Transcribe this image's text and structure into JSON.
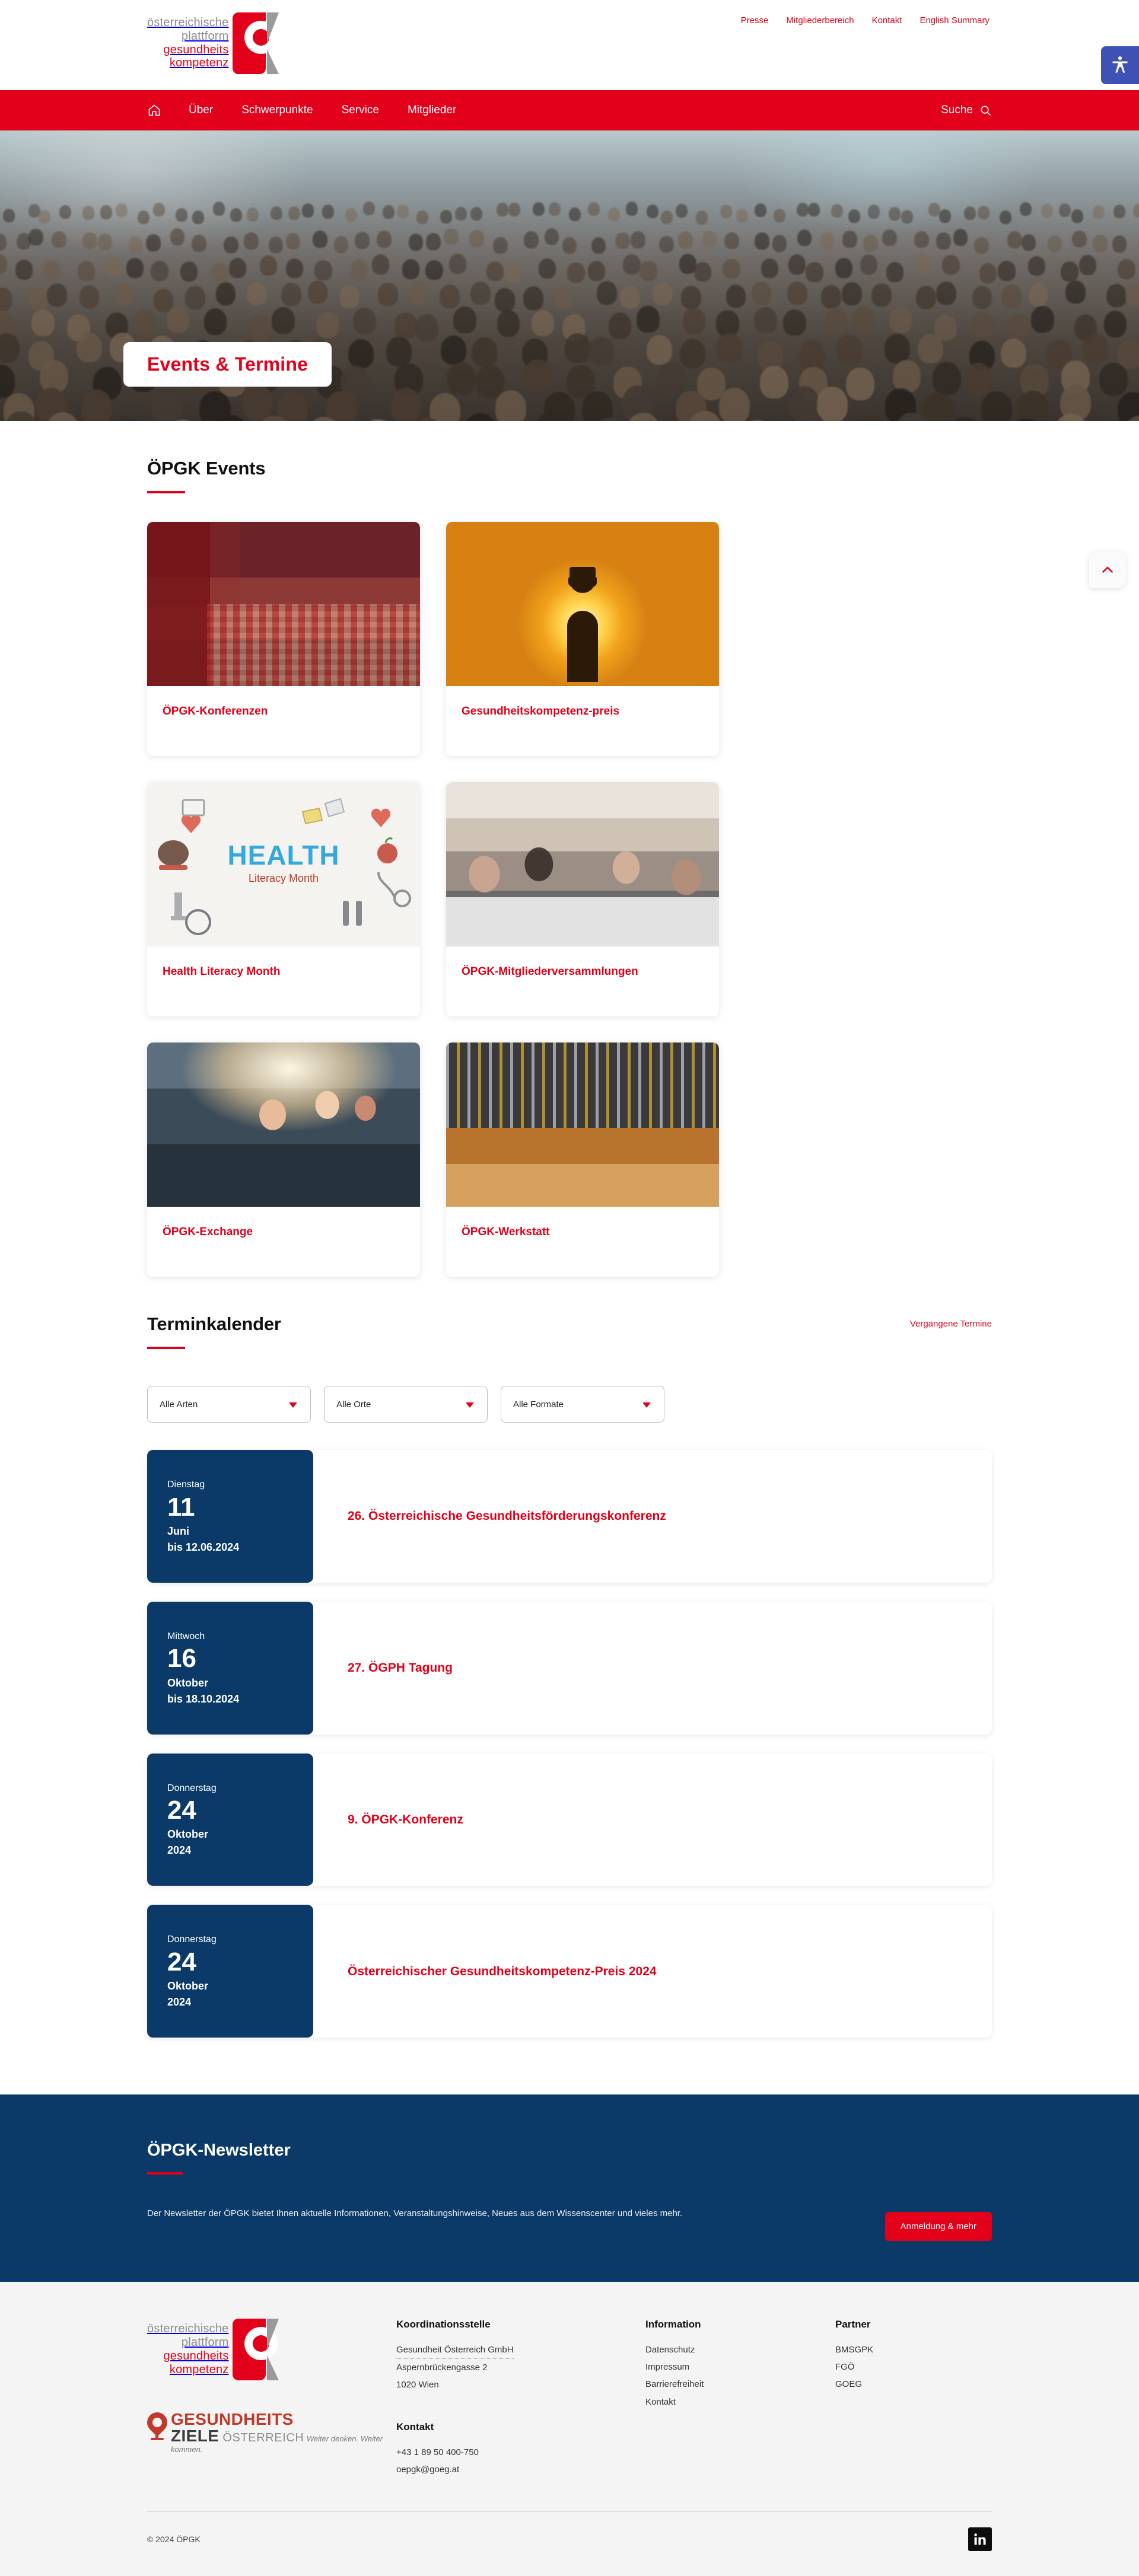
{
  "brand": {
    "accent_red": "#e2001a",
    "navy": "#0b3a69",
    "logo_line1": "österreichische",
    "logo_line2": "plattform",
    "logo_line3": "gesundheits",
    "logo_line4": "kompetenz"
  },
  "topbar": {
    "links": [
      {
        "label": "Presse"
      },
      {
        "label": "Mitgliederbereich"
      },
      {
        "label": "Kontakt"
      },
      {
        "label": "English Summary"
      }
    ],
    "accessibility_icon": "accessibility-person-icon"
  },
  "nav": {
    "home_icon": "home-icon",
    "items": [
      {
        "label": "Über"
      },
      {
        "label": "Schwerpunkte"
      },
      {
        "label": "Service"
      },
      {
        "label": "Mitglieder"
      }
    ],
    "search_label": "Suche",
    "search_icon": "search-icon"
  },
  "hero": {
    "badge_title": "Events & Termine"
  },
  "scroll_top": {
    "icon": "chevron-up-icon"
  },
  "events_section": {
    "title": "ÖPGK Events",
    "cards": [
      {
        "title": "ÖPGK-Konferenzen",
        "art": "art-conf"
      },
      {
        "title": "Gesundheitskompetenz-preis",
        "art": "art-trophy"
      },
      {
        "title": "Health Literacy Month",
        "art": "art-health"
      },
      {
        "title": "ÖPGK-Mitgliederversammlungen",
        "art": "art-meet"
      },
      {
        "title": "ÖPGK-Exchange",
        "art": "art-exch"
      },
      {
        "title": "ÖPGK-Werkstatt",
        "art": "art-werk"
      }
    ]
  },
  "calendar": {
    "title": "Terminkalender",
    "past_link": "Vergangene Termine",
    "filters": [
      {
        "label": "Alle Arten"
      },
      {
        "label": "Alle Orte"
      },
      {
        "label": "Alle Formate"
      }
    ],
    "entries": [
      {
        "weekday": "Dienstag",
        "day": "11",
        "month": "Juni",
        "until": "bis 12.06.2024",
        "title": "26. Österreichische Gesundheitsförderungskonferenz"
      },
      {
        "weekday": "Mittwoch",
        "day": "16",
        "month": "Oktober",
        "until": "bis 18.10.2024",
        "title": "27. ÖGPH Tagung"
      },
      {
        "weekday": "Donnerstag",
        "day": "24",
        "month": "Oktober",
        "until": "2024",
        "title": "9. ÖPGK-Konferenz"
      },
      {
        "weekday": "Donnerstag",
        "day": "24",
        "month": "Oktober",
        "until": "2024",
        "title": "Österreichischer Gesundheitskompetenz-Preis 2024"
      }
    ]
  },
  "newsletter": {
    "title": "ÖPGK-Newsletter",
    "text": "Der Newsletter der ÖPGK bietet Ihnen aktuelle Informationen, Veranstaltungshinweise, Neues aus dem Wissenscenter und vieles mehr.",
    "button_label": "Anmeldung & mehr"
  },
  "footer": {
    "gz_logo": {
      "line1": "GESUNDHEITS",
      "line2_bold": "ZIELE",
      "line2_light": "ÖSTERREICH",
      "tagline": "Weiter denken. Weiter kommen."
    },
    "koordination": {
      "heading": "Koordinationsstelle",
      "org": "Gesundheit Österreich GmbH",
      "street": "Aspernbrückengasse 2",
      "city": "1020 Wien",
      "contact_heading": "Kontakt",
      "phone": "+43 1 89 50 400-750",
      "email": "oepgk@goeg.at"
    },
    "information": {
      "heading": "Information",
      "links": [
        {
          "label": "Datenschutz"
        },
        {
          "label": "Impressum"
        },
        {
          "label": "Barrierefreiheit"
        },
        {
          "label": "Kontakt"
        }
      ]
    },
    "partner": {
      "heading": "Partner",
      "links": [
        {
          "label": "BMSGPK"
        },
        {
          "label": "FGÖ"
        },
        {
          "label": "GOEG"
        }
      ]
    },
    "copyright": "© 2024 ÖPGK",
    "social_icon": "linkedin-icon"
  }
}
